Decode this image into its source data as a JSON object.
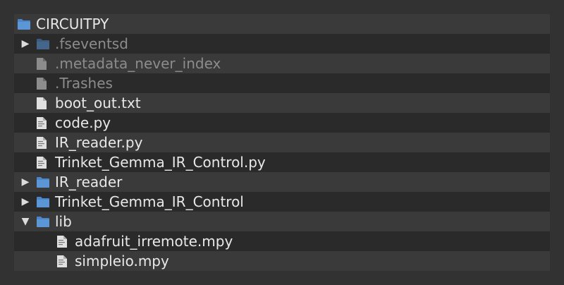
{
  "colors": {
    "folder": "#4a86c8",
    "file": "#d8d8d8",
    "file_dim": "#8c8c8c",
    "text": "#e8e8e8",
    "text_dim": "#8c8c8c",
    "row_alt": "#3a3a3a",
    "panel": "#2a2a2a",
    "page": "#323232"
  },
  "tree": {
    "root": {
      "label": "CIRCUITPY",
      "icon": "folder-icon"
    },
    "items": [
      {
        "label": ".fseventsd",
        "icon": "folder-icon",
        "arrow": "▶",
        "dim": true
      },
      {
        "label": ".metadata_never_index",
        "icon": "file-icon",
        "dim": true
      },
      {
        "label": ".Trashes",
        "icon": "file-icon",
        "dim": true
      },
      {
        "label": "boot_out.txt",
        "icon": "file-icon"
      },
      {
        "label": "code.py",
        "icon": "code-file-icon"
      },
      {
        "label": "IR_reader.py",
        "icon": "code-file-icon"
      },
      {
        "label": "Trinket_Gemma_IR_Control.py",
        "icon": "code-file-icon"
      },
      {
        "label": "IR_reader",
        "icon": "folder-icon",
        "arrow": "▶"
      },
      {
        "label": "Trinket_Gemma_IR_Control",
        "icon": "folder-icon",
        "arrow": "▶"
      },
      {
        "label": "lib",
        "icon": "folder-icon",
        "arrow": "▼"
      }
    ],
    "lib_items": [
      {
        "label": "adafruit_irremote.mpy",
        "icon": "code-file-icon"
      },
      {
        "label": "simpleio.mpy",
        "icon": "code-file-icon"
      }
    ]
  }
}
